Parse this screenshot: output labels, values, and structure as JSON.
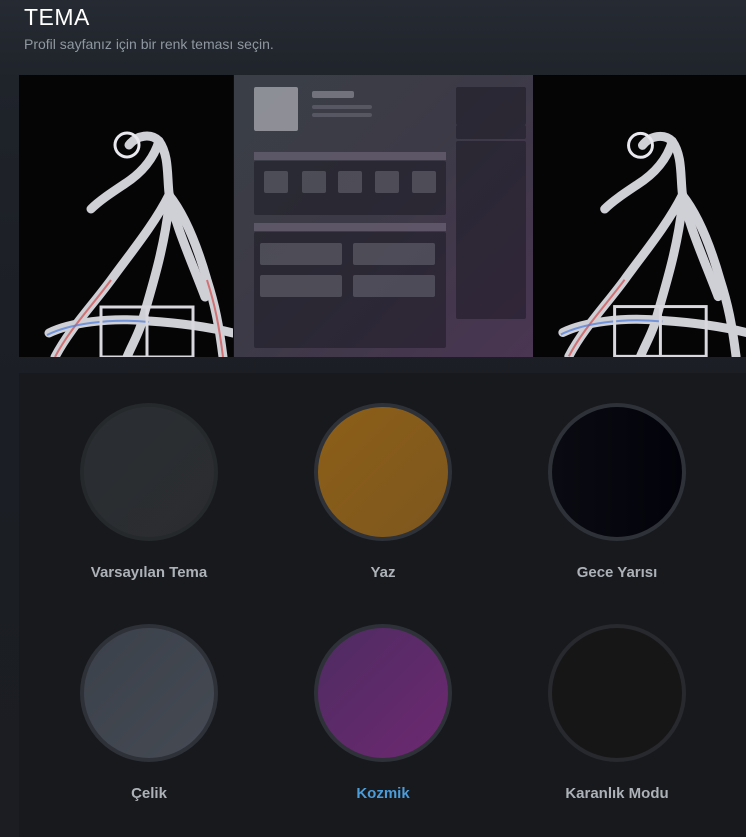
{
  "header": {
    "title": "TEMA",
    "subtitle": "Profil sayfanız için bir renk teması seçin."
  },
  "themes": [
    {
      "name": "Varsayılan Tema",
      "color": "#2a2d30",
      "ring": "#26292c",
      "selected": false
    },
    {
      "name": "Yaz",
      "color": "#8a5e1a",
      "ring": "#2e3138",
      "selected": false
    },
    {
      "name": "Gece Yarısı",
      "color": "#04050c",
      "ring": "#2e3138",
      "selected": false
    },
    {
      "name": "Çelik",
      "color": "#3f444d",
      "ring": "#2e3138",
      "selected": false
    },
    {
      "name": "Kozmik",
      "color": "#622a6b",
      "ring": "#2e3138",
      "selected": true
    },
    {
      "name": "Karanlık Modu",
      "color": "#171617",
      "ring": "#2e3138",
      "selected": false
    }
  ],
  "colors": {
    "accent": "#4b9cdb",
    "label": "#acb2b8"
  }
}
